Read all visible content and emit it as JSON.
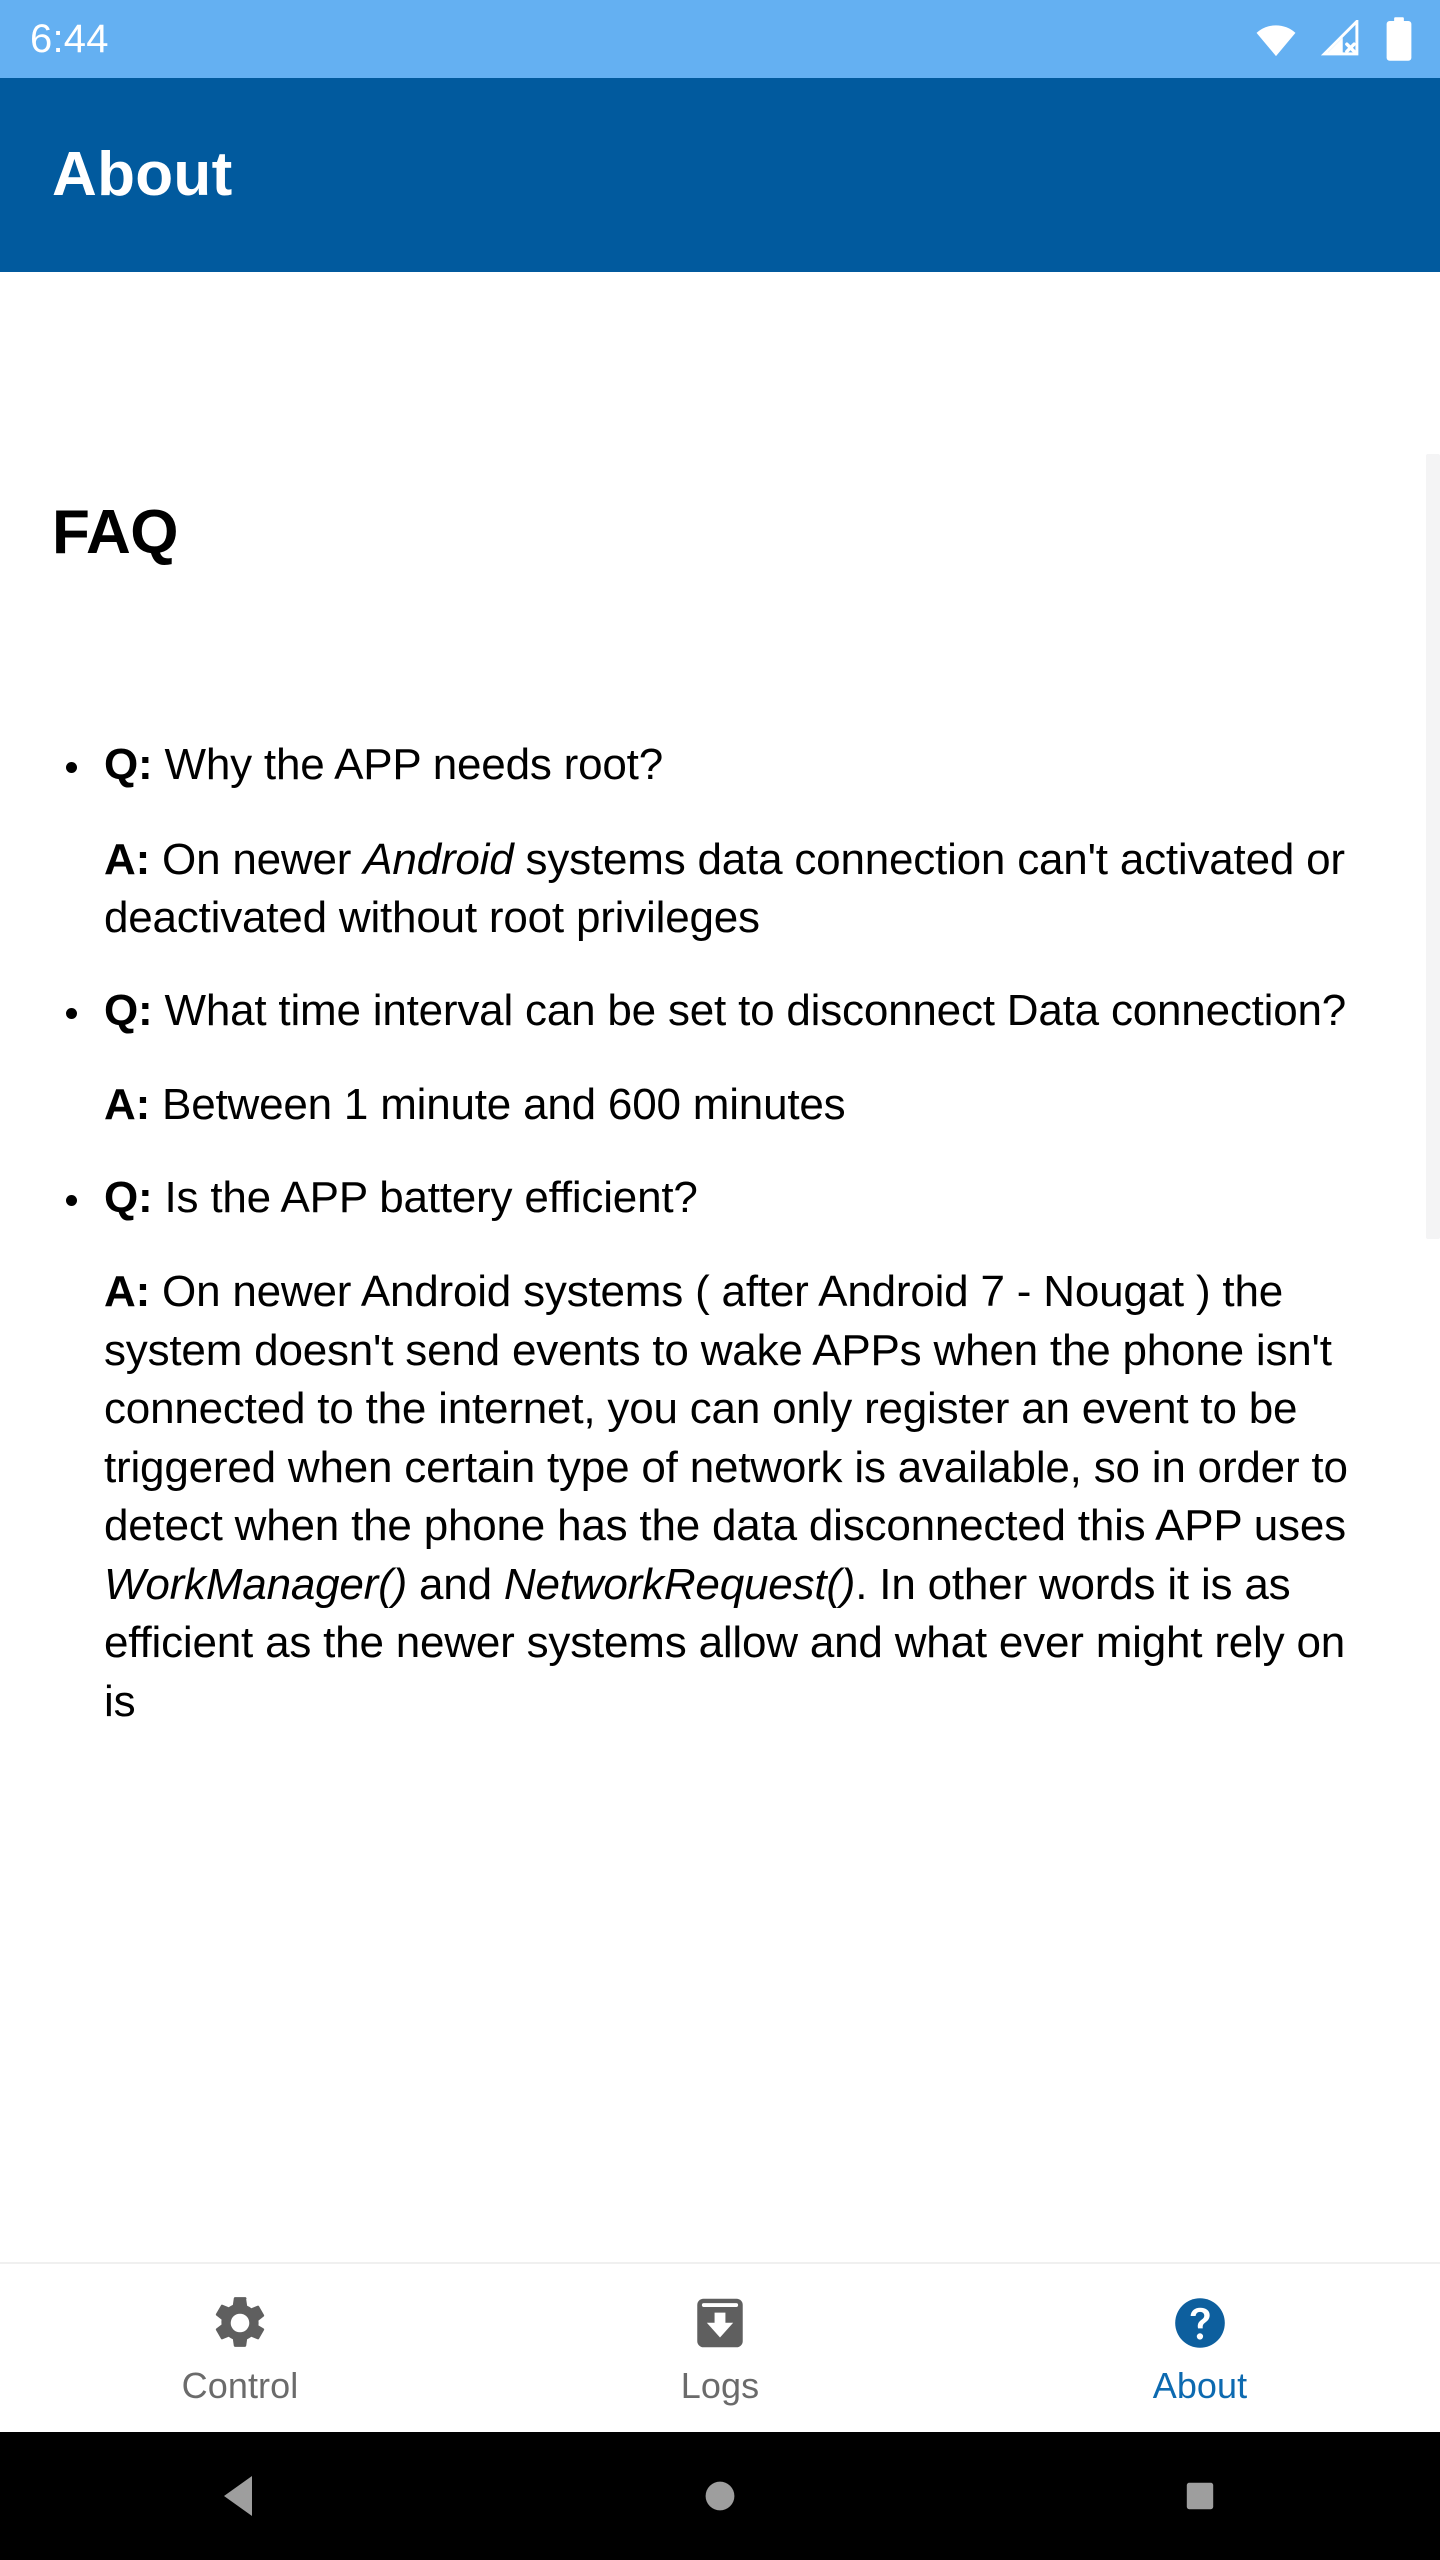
{
  "status_bar": {
    "clock": "6:44",
    "icons": [
      "wifi-icon",
      "cellular-off-icon",
      "battery-full-icon"
    ],
    "background_color": "#64b0f2",
    "foreground_color": "#ffffff"
  },
  "app_bar": {
    "title": "About",
    "background_color": "#015a9e",
    "title_color": "#ffffff"
  },
  "main": {
    "heading": "FAQ",
    "faq": [
      {
        "q_label": "Q:",
        "question_parts": [
          {
            "text": " Why the APP needs root?",
            "italic": false
          }
        ],
        "a_label": "A:",
        "answer_parts": [
          {
            "text": " On newer ",
            "italic": false
          },
          {
            "text": "Android",
            "italic": true
          },
          {
            "text": " systems data connection can't activated or deactivated without root privileges",
            "italic": false
          }
        ]
      },
      {
        "q_label": "Q:",
        "question_parts": [
          {
            "text": " What time interval can be set to disconnect Data connection?",
            "italic": false
          }
        ],
        "a_label": "A:",
        "answer_parts": [
          {
            "text": " Between 1 minute and 600 minutes",
            "italic": false
          }
        ]
      },
      {
        "q_label": "Q:",
        "question_parts": [
          {
            "text": " Is the APP battery efficient?",
            "italic": false
          }
        ],
        "a_label": "A:",
        "answer_parts": [
          {
            "text": " On newer Android systems ( after Android 7 - Nougat ) the system doesn't send events to wake APPs when the phone isn't connected to the internet, you can only register an event to be triggered when certain type of network is available, so in order to detect when the phone has the data disconnected this APP uses ",
            "italic": false
          },
          {
            "text": "WorkManager()",
            "italic": true
          },
          {
            "text": " and ",
            "italic": false
          },
          {
            "text": "NetworkRequest()",
            "italic": true
          },
          {
            "text": ". In other words it is as efficient as the newer systems allow and what ever might rely on is",
            "italic": false
          }
        ]
      }
    ],
    "scrollbar_color": "#f4f4f5"
  },
  "bottom_nav": {
    "active_color": "#0d6ab0",
    "inactive_color": "#6b6b6b",
    "tabs": [
      {
        "label": "Control",
        "icon": "gear-icon",
        "active": false
      },
      {
        "label": "Logs",
        "icon": "archive-download-icon",
        "active": false
      },
      {
        "label": "About",
        "icon": "help-circle-icon",
        "active": true
      }
    ]
  },
  "system_nav": {
    "background_color": "#000000",
    "icon_color": "#9e9e9e",
    "buttons": [
      {
        "name": "back",
        "icon": "triangle-back-icon"
      },
      {
        "name": "home",
        "icon": "circle-home-icon"
      },
      {
        "name": "recents",
        "icon": "square-recents-icon"
      }
    ]
  }
}
